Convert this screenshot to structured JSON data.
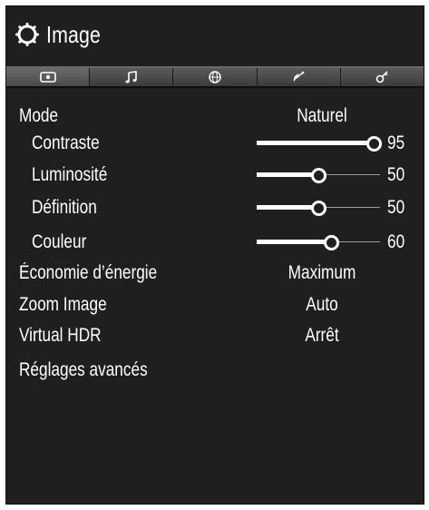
{
  "menu": {
    "title": "Image",
    "title_icon": "gear-icon",
    "tabs": [
      {
        "icon": "picture-icon",
        "active": true
      },
      {
        "icon": "music-note-icon",
        "active": false
      },
      {
        "icon": "globe-icon",
        "active": false
      },
      {
        "icon": "satellite-dish-icon",
        "active": false
      },
      {
        "icon": "settings-key-icon",
        "active": false
      }
    ]
  },
  "settings": {
    "mode": {
      "label": "Mode",
      "value": "Naturel"
    },
    "contrast": {
      "label": "Contraste",
      "value": "95",
      "level": 95
    },
    "brightness": {
      "label": "Luminosité",
      "value": "50",
      "level": 50
    },
    "sharpness": {
      "label": "Définition",
      "value": "50",
      "level": 50
    },
    "color": {
      "label": "Couleur",
      "value": "60",
      "level": 60
    },
    "energy": {
      "label": "Économie d’énergie",
      "value": "Maximum"
    },
    "zoom": {
      "label": "Zoom Image",
      "value": "Auto"
    },
    "hdr": {
      "label": "Virtual HDR",
      "value": "Arrêt"
    },
    "advanced": {
      "label": "Réglages avancés"
    }
  },
  "colors": {
    "background": "#1f1f1f",
    "text": "#ffffff",
    "track": "#9a9a9a"
  }
}
